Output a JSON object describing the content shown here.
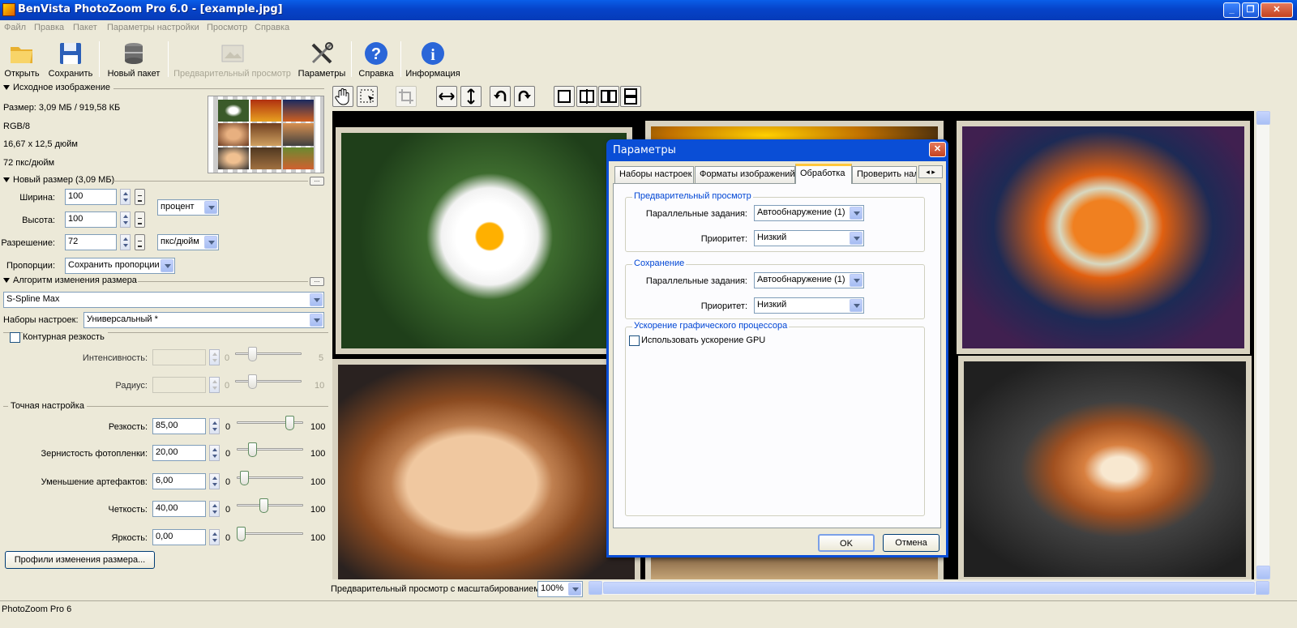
{
  "window": {
    "title": "BenVista PhotoZoom Pro 6.0 - [example.jpg]"
  },
  "menu": [
    "Файл",
    "Правка",
    "Пакет",
    "Параметры настройки",
    "Просмотр",
    "Справка"
  ],
  "toolbar": {
    "open": "Открыть",
    "save": "Сохранить",
    "new_batch": "Новый пакет",
    "preview": "Предварительный просмотр",
    "settings": "Параметры",
    "help": "Справка",
    "info": "Информация"
  },
  "source": {
    "header": "Исходное изображение",
    "size": "Размер: 3,09 МБ / 919,58 КБ",
    "mode": "RGB/8",
    "dimensions": "16,67 x 12,5 дюйм",
    "dpi": "72 пкс/дюйм"
  },
  "new_size": {
    "header": "Новый размер (3,09 МБ)",
    "width_label": "Ширина:",
    "width": "100",
    "height_label": "Высота:",
    "height": "100",
    "unit": "процент",
    "res_label": "Разрешение:",
    "res": "72",
    "res_unit": "пкс/дюйм",
    "prop_label": "Пропорции:",
    "prop": "Сохранить пропорции"
  },
  "algo": {
    "header": "Алгоритм изменения размера",
    "method": "S-Spline Max",
    "presets_label": "Наборы настроек:",
    "preset": "Универсальный *"
  },
  "unsharp": {
    "label": "Контурная резкость",
    "intensity_label": "Интенсивность:",
    "intensity_min": "0",
    "intensity_max": "5",
    "radius_label": "Радиус:",
    "radius_min": "0",
    "radius_max": "10"
  },
  "fine": {
    "header": "Точная настройка",
    "rows": [
      {
        "label": "Резкость:",
        "value": "85,00",
        "min": "0",
        "max": "100",
        "level": 85
      },
      {
        "label": "Зернистость фотопленки:",
        "value": "20,00",
        "min": "0",
        "max": "100",
        "level": 20
      },
      {
        "label": "Уменьшение артефактов:",
        "value": "6,00",
        "min": "0",
        "max": "100",
        "level": 6
      },
      {
        "label": "Четкость:",
        "value": "40,00",
        "min": "0",
        "max": "100",
        "level": 40
      },
      {
        "label": "Яркость:",
        "value": "0,00",
        "min": "0",
        "max": "100",
        "level": 0
      }
    ],
    "profiles_button": "Профили изменения размера..."
  },
  "preview_bar": {
    "label": "Предварительный просмотр с масштабированием:",
    "zoom": "100%"
  },
  "status": "PhotoZoom Pro 6",
  "dialog": {
    "title": "Параметры",
    "tabs": [
      "Наборы настроек",
      "Форматы изображений",
      "Обработка",
      "Проверить нал"
    ],
    "group1": {
      "title": "Предварительный просмотр",
      "jobs_label": "Параллельные задания:",
      "jobs": "Автообнаружение (1)",
      "prio_label": "Приоритет:",
      "prio": "Низкий"
    },
    "group2": {
      "title": "Сохранение",
      "jobs_label": "Параллельные задания:",
      "jobs": "Автообнаружение (1)",
      "prio_label": "Приоритет:",
      "prio": "Низкий"
    },
    "group3": {
      "title": "Ускорение графического процессора",
      "gpu_label": "Использовать ускорение GPU"
    },
    "ok": "OK",
    "cancel": "Отмена"
  }
}
